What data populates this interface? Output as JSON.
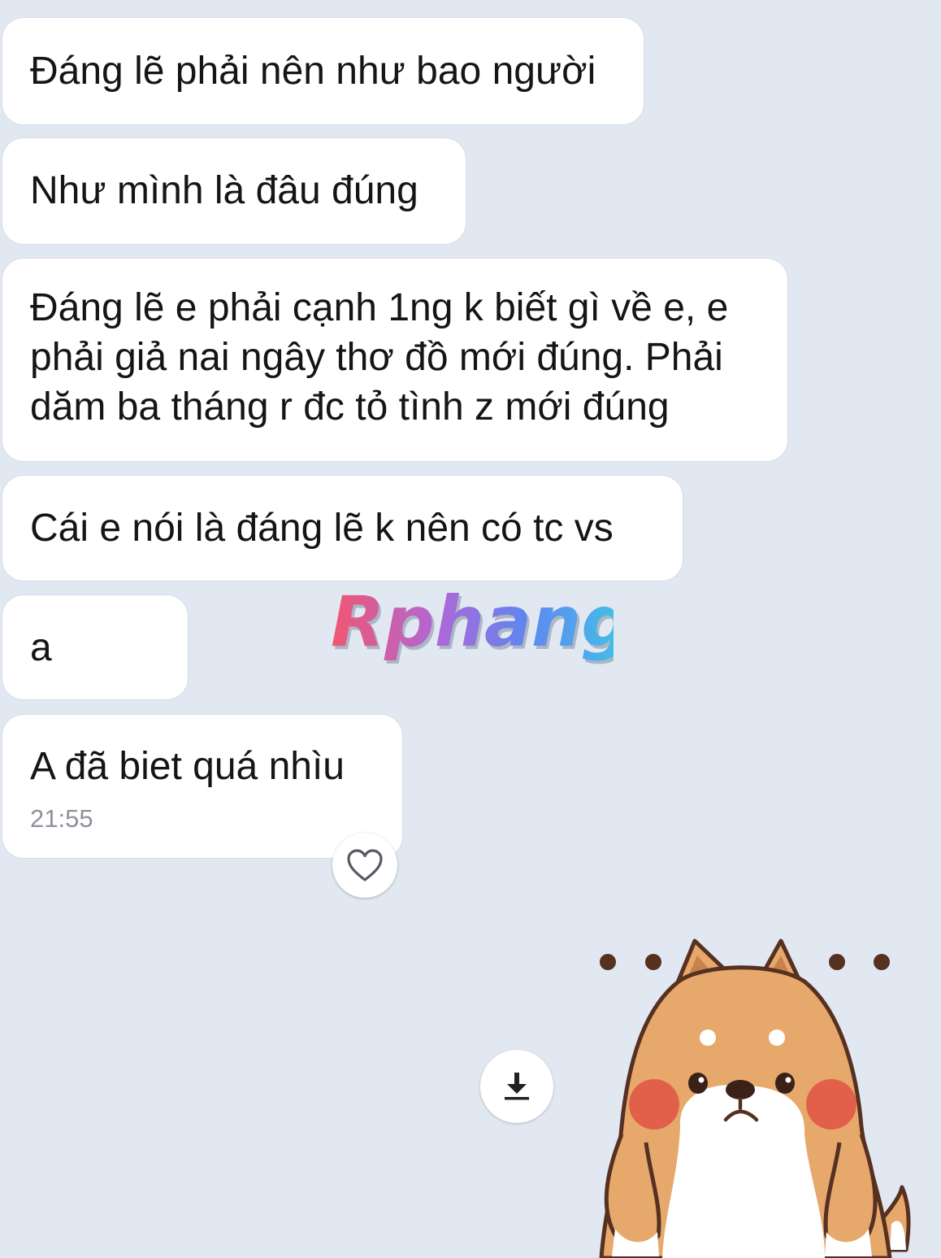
{
  "messages": [
    {
      "text": "Đáng lẽ phải nên như bao người"
    },
    {
      "text": "Như mình là đâu đúng"
    },
    {
      "text": "Đáng lẽ e phải cạnh 1ng k biết gì về e, e\nphải giả nai ngây thơ đồ mới đúng. Phải\ndăm ba tháng r đc tỏ tình z mới đúng"
    },
    {
      "text": "Cái e nói là đáng lẽ k nên có tc vs"
    },
    {
      "text": "a"
    },
    {
      "text": "A đã biet quá nhìu",
      "time": "21:55"
    }
  ],
  "watermark": {
    "text": "Rphang"
  },
  "icons": {
    "reaction": "heart-icon",
    "download": "download-icon"
  },
  "sticker": {
    "name": "shiba-dog-sticker"
  },
  "colors": {
    "background": "#e2e8f1",
    "bubble": "#ffffff",
    "text": "#151515",
    "timestamp": "#8d939c",
    "sticker_fur": "#e7a86b",
    "sticker_outline": "#563021",
    "sticker_cheeks": "#e2604a"
  }
}
